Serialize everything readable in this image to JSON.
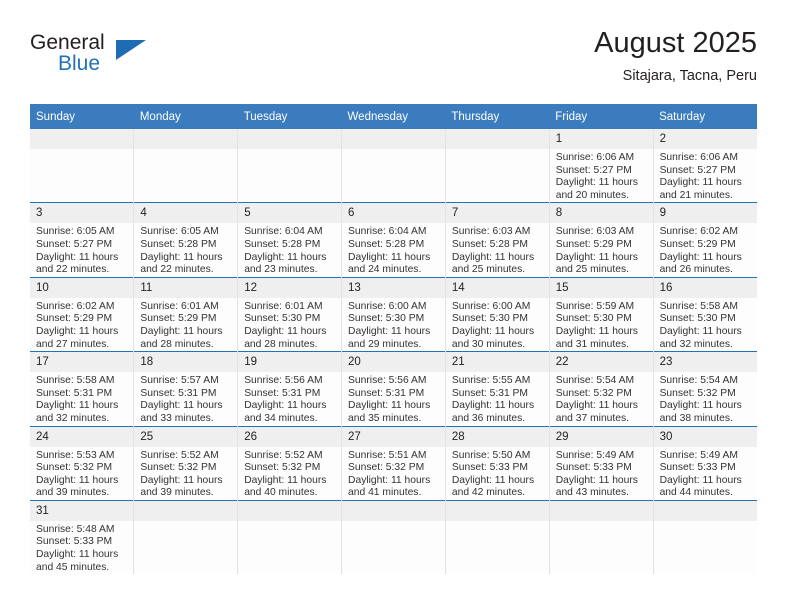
{
  "brand": {
    "name_part1": "General",
    "name_part2": "Blue",
    "triangle_color": "#1d6cb4"
  },
  "header": {
    "title": "August 2025",
    "subtitle": "Sitajara, Tacna, Peru"
  },
  "theme": {
    "header_blue": "#3a7cbe",
    "row_separator_blue": "#2272b8",
    "daynum_bg": "#efefef"
  },
  "weekday_headers": [
    "Sunday",
    "Monday",
    "Tuesday",
    "Wednesday",
    "Thursday",
    "Friday",
    "Saturday"
  ],
  "weeks": [
    [
      {
        "day": "",
        "lines": []
      },
      {
        "day": "",
        "lines": []
      },
      {
        "day": "",
        "lines": []
      },
      {
        "day": "",
        "lines": []
      },
      {
        "day": "",
        "lines": []
      },
      {
        "day": "1",
        "lines": [
          "Sunrise: 6:06 AM",
          "Sunset: 5:27 PM",
          "Daylight: 11 hours",
          "and 20 minutes."
        ]
      },
      {
        "day": "2",
        "lines": [
          "Sunrise: 6:06 AM",
          "Sunset: 5:27 PM",
          "Daylight: 11 hours",
          "and 21 minutes."
        ]
      }
    ],
    [
      {
        "day": "3",
        "lines": [
          "Sunrise: 6:05 AM",
          "Sunset: 5:27 PM",
          "Daylight: 11 hours",
          "and 22 minutes."
        ]
      },
      {
        "day": "4",
        "lines": [
          "Sunrise: 6:05 AM",
          "Sunset: 5:28 PM",
          "Daylight: 11 hours",
          "and 22 minutes."
        ]
      },
      {
        "day": "5",
        "lines": [
          "Sunrise: 6:04 AM",
          "Sunset: 5:28 PM",
          "Daylight: 11 hours",
          "and 23 minutes."
        ]
      },
      {
        "day": "6",
        "lines": [
          "Sunrise: 6:04 AM",
          "Sunset: 5:28 PM",
          "Daylight: 11 hours",
          "and 24 minutes."
        ]
      },
      {
        "day": "7",
        "lines": [
          "Sunrise: 6:03 AM",
          "Sunset: 5:28 PM",
          "Daylight: 11 hours",
          "and 25 minutes."
        ]
      },
      {
        "day": "8",
        "lines": [
          "Sunrise: 6:03 AM",
          "Sunset: 5:29 PM",
          "Daylight: 11 hours",
          "and 25 minutes."
        ]
      },
      {
        "day": "9",
        "lines": [
          "Sunrise: 6:02 AM",
          "Sunset: 5:29 PM",
          "Daylight: 11 hours",
          "and 26 minutes."
        ]
      }
    ],
    [
      {
        "day": "10",
        "lines": [
          "Sunrise: 6:02 AM",
          "Sunset: 5:29 PM",
          "Daylight: 11 hours",
          "and 27 minutes."
        ]
      },
      {
        "day": "11",
        "lines": [
          "Sunrise: 6:01 AM",
          "Sunset: 5:29 PM",
          "Daylight: 11 hours",
          "and 28 minutes."
        ]
      },
      {
        "day": "12",
        "lines": [
          "Sunrise: 6:01 AM",
          "Sunset: 5:30 PM",
          "Daylight: 11 hours",
          "and 28 minutes."
        ]
      },
      {
        "day": "13",
        "lines": [
          "Sunrise: 6:00 AM",
          "Sunset: 5:30 PM",
          "Daylight: 11 hours",
          "and 29 minutes."
        ]
      },
      {
        "day": "14",
        "lines": [
          "Sunrise: 6:00 AM",
          "Sunset: 5:30 PM",
          "Daylight: 11 hours",
          "and 30 minutes."
        ]
      },
      {
        "day": "15",
        "lines": [
          "Sunrise: 5:59 AM",
          "Sunset: 5:30 PM",
          "Daylight: 11 hours",
          "and 31 minutes."
        ]
      },
      {
        "day": "16",
        "lines": [
          "Sunrise: 5:58 AM",
          "Sunset: 5:30 PM",
          "Daylight: 11 hours",
          "and 32 minutes."
        ]
      }
    ],
    [
      {
        "day": "17",
        "lines": [
          "Sunrise: 5:58 AM",
          "Sunset: 5:31 PM",
          "Daylight: 11 hours",
          "and 32 minutes."
        ]
      },
      {
        "day": "18",
        "lines": [
          "Sunrise: 5:57 AM",
          "Sunset: 5:31 PM",
          "Daylight: 11 hours",
          "and 33 minutes."
        ]
      },
      {
        "day": "19",
        "lines": [
          "Sunrise: 5:56 AM",
          "Sunset: 5:31 PM",
          "Daylight: 11 hours",
          "and 34 minutes."
        ]
      },
      {
        "day": "20",
        "lines": [
          "Sunrise: 5:56 AM",
          "Sunset: 5:31 PM",
          "Daylight: 11 hours",
          "and 35 minutes."
        ]
      },
      {
        "day": "21",
        "lines": [
          "Sunrise: 5:55 AM",
          "Sunset: 5:31 PM",
          "Daylight: 11 hours",
          "and 36 minutes."
        ]
      },
      {
        "day": "22",
        "lines": [
          "Sunrise: 5:54 AM",
          "Sunset: 5:32 PM",
          "Daylight: 11 hours",
          "and 37 minutes."
        ]
      },
      {
        "day": "23",
        "lines": [
          "Sunrise: 5:54 AM",
          "Sunset: 5:32 PM",
          "Daylight: 11 hours",
          "and 38 minutes."
        ]
      }
    ],
    [
      {
        "day": "24",
        "lines": [
          "Sunrise: 5:53 AM",
          "Sunset: 5:32 PM",
          "Daylight: 11 hours",
          "and 39 minutes."
        ]
      },
      {
        "day": "25",
        "lines": [
          "Sunrise: 5:52 AM",
          "Sunset: 5:32 PM",
          "Daylight: 11 hours",
          "and 39 minutes."
        ]
      },
      {
        "day": "26",
        "lines": [
          "Sunrise: 5:52 AM",
          "Sunset: 5:32 PM",
          "Daylight: 11 hours",
          "and 40 minutes."
        ]
      },
      {
        "day": "27",
        "lines": [
          "Sunrise: 5:51 AM",
          "Sunset: 5:32 PM",
          "Daylight: 11 hours",
          "and 41 minutes."
        ]
      },
      {
        "day": "28",
        "lines": [
          "Sunrise: 5:50 AM",
          "Sunset: 5:33 PM",
          "Daylight: 11 hours",
          "and 42 minutes."
        ]
      },
      {
        "day": "29",
        "lines": [
          "Sunrise: 5:49 AM",
          "Sunset: 5:33 PM",
          "Daylight: 11 hours",
          "and 43 minutes."
        ]
      },
      {
        "day": "30",
        "lines": [
          "Sunrise: 5:49 AM",
          "Sunset: 5:33 PM",
          "Daylight: 11 hours",
          "and 44 minutes."
        ]
      }
    ],
    [
      {
        "day": "31",
        "lines": [
          "Sunrise: 5:48 AM",
          "Sunset: 5:33 PM",
          "Daylight: 11 hours",
          "and 45 minutes."
        ]
      },
      {
        "day": "",
        "lines": []
      },
      {
        "day": "",
        "lines": []
      },
      {
        "day": "",
        "lines": []
      },
      {
        "day": "",
        "lines": []
      },
      {
        "day": "",
        "lines": []
      },
      {
        "day": "",
        "lines": []
      }
    ]
  ]
}
